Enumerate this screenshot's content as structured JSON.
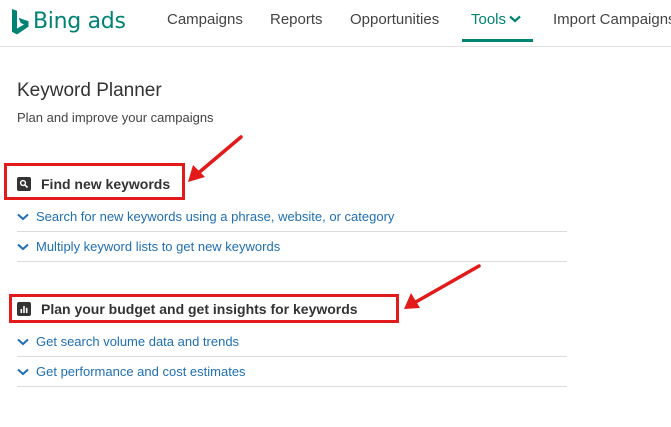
{
  "brand": {
    "name": "Bing ads",
    "color": "#008373"
  },
  "nav": {
    "items": [
      {
        "label": "Campaigns"
      },
      {
        "label": "Reports"
      },
      {
        "label": "Opportunities"
      },
      {
        "label": "Tools",
        "active": true,
        "has_dropdown": true
      },
      {
        "label": "Import Campaigns"
      }
    ]
  },
  "page": {
    "title": "Keyword Planner",
    "subtitle": "Plan and improve your campaigns"
  },
  "sections": [
    {
      "heading": "Find new keywords",
      "icon": "search-icon",
      "highlighted": true,
      "items": [
        {
          "label": "Search for new keywords using a phrase, website, or category"
        },
        {
          "label": "Multiply keyword lists to get new keywords"
        }
      ]
    },
    {
      "heading": "Plan your budget and get insights for keywords",
      "icon": "bar-chart-icon",
      "highlighted": true,
      "items": [
        {
          "label": "Get search volume data and trends"
        },
        {
          "label": "Get performance and cost estimates"
        }
      ]
    }
  ],
  "colors": {
    "link": "#1f6fb2",
    "highlight": "#e21a1a",
    "divider": "#dcdcdc"
  }
}
